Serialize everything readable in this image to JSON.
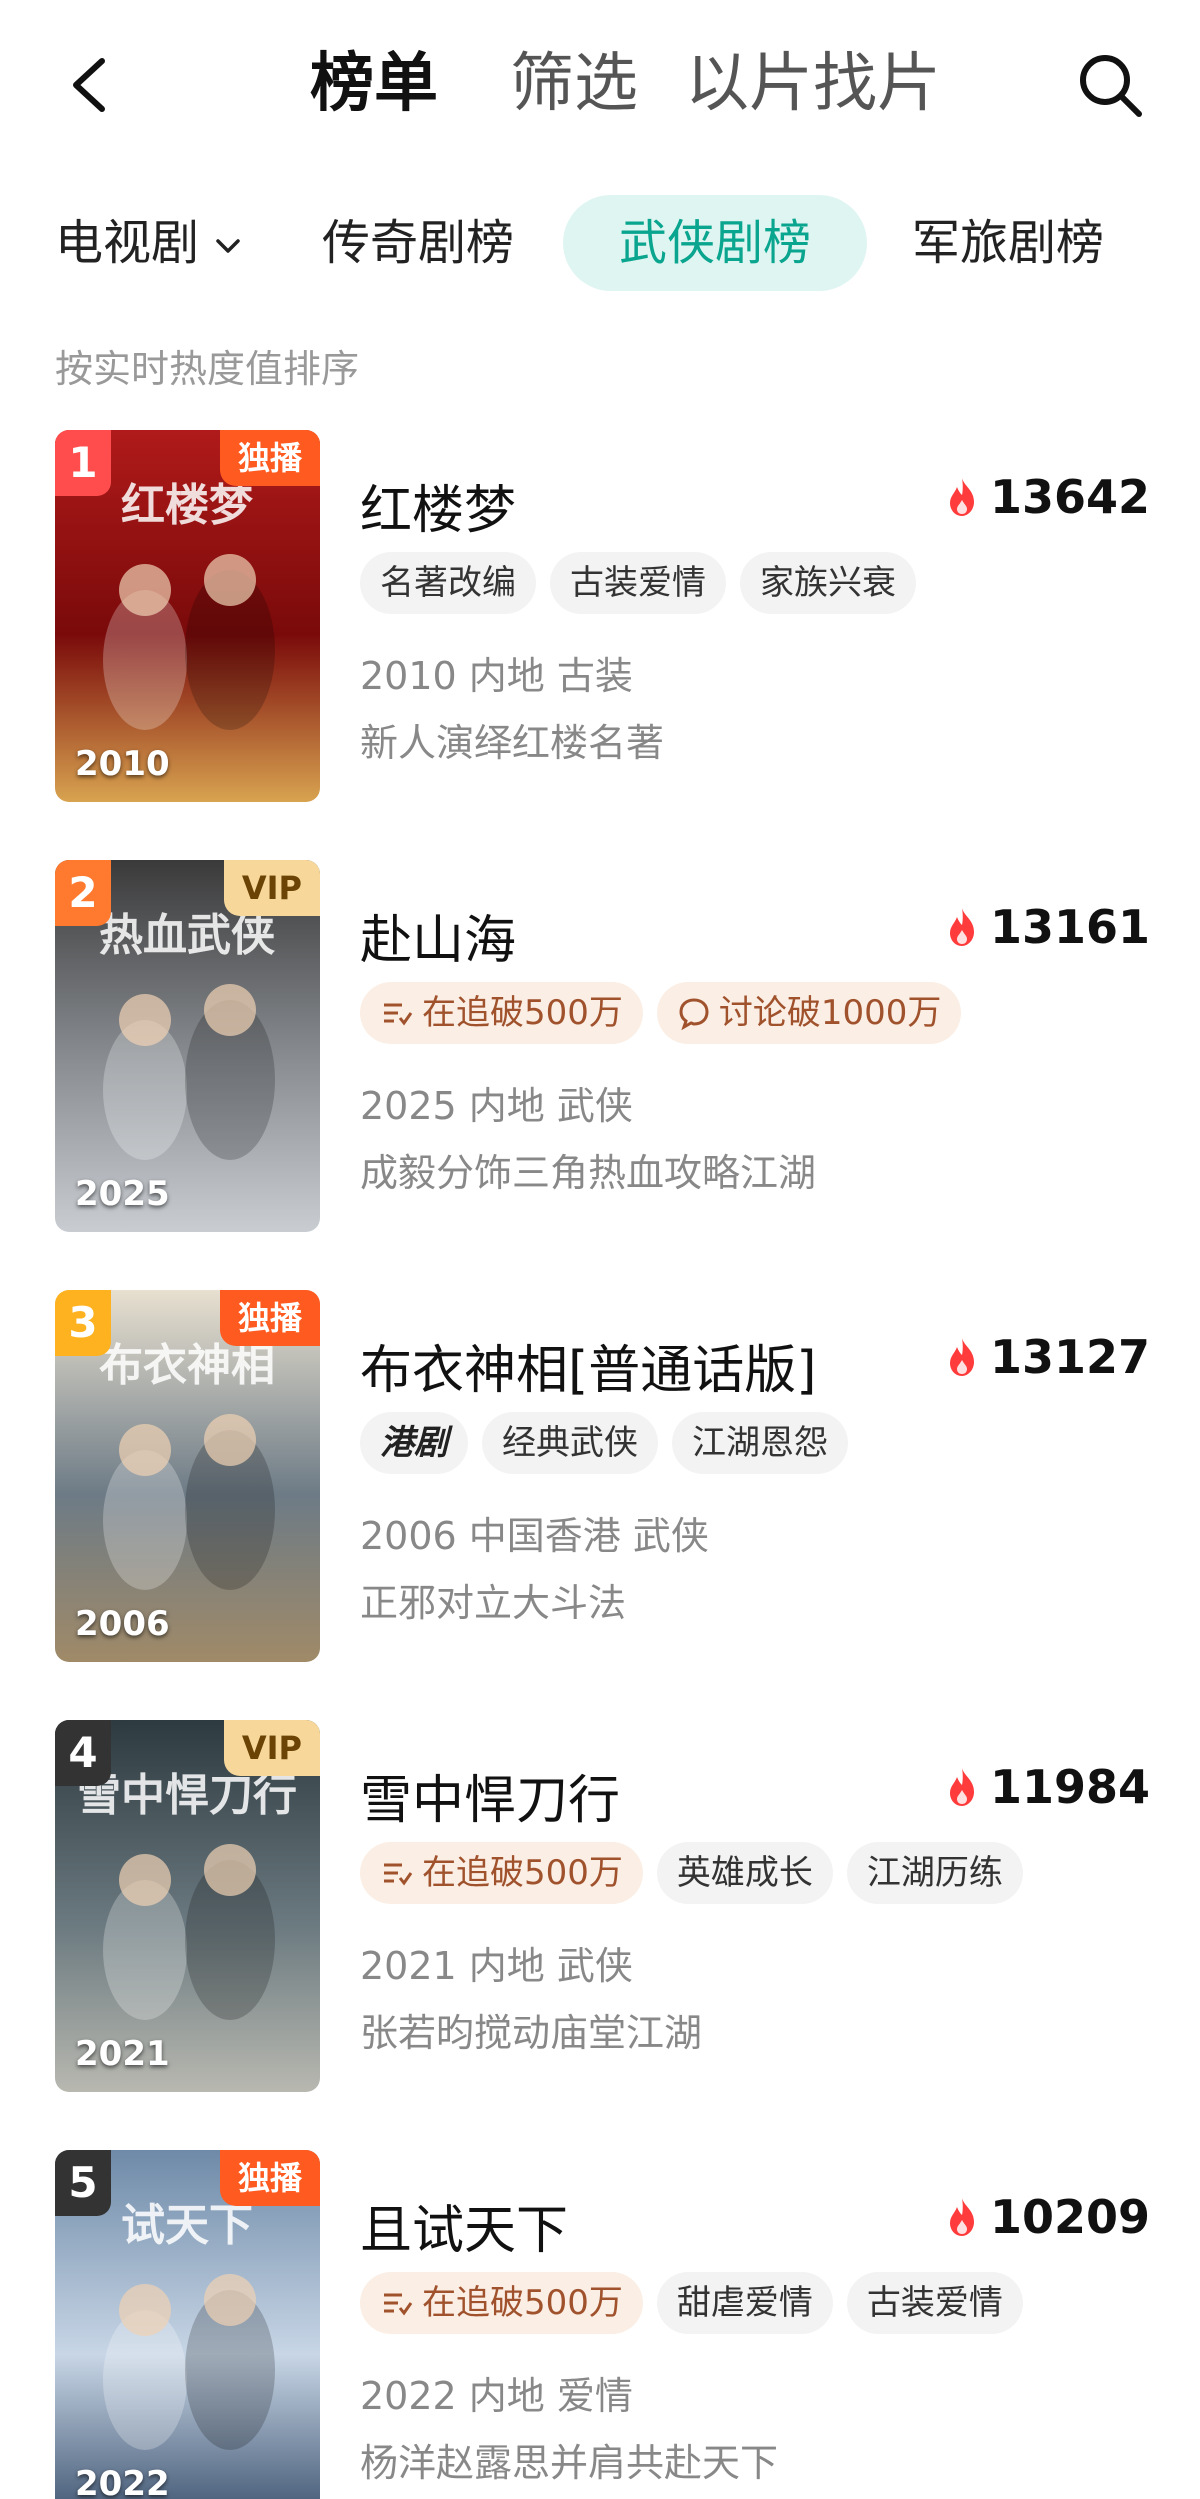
{
  "nav": {
    "tabs": [
      "榜单",
      "筛选",
      "以片找片"
    ]
  },
  "categories": {
    "dropdown": "电视剧",
    "items": [
      "传奇剧榜",
      "武侠剧榜",
      "军旅剧榜"
    ],
    "active_index": 1
  },
  "sort_note": "按实时热度值排序",
  "colors": {
    "accent": "#0aa58e",
    "accent_bg": "#dff5f1",
    "flame": "#ff3b3b",
    "exclusive": "#ff5a1f",
    "vip": "#f7d89a"
  },
  "items": [
    {
      "rank": "1",
      "badge": "独播",
      "year": "2010",
      "title": "红楼梦",
      "heat": "13642",
      "tags": [
        "名著改编",
        "古装爱情",
        "家族兴衰"
      ],
      "meta": "2010 内地 古装",
      "desc": "新人演绎红楼名著",
      "poster_text": "红楼梦"
    },
    {
      "rank": "2",
      "badge": "VIP",
      "year": "2025",
      "title": "赴山海",
      "heat": "13161",
      "tags": [
        "在追破500万",
        "讨论破1000万"
      ],
      "meta": "2025 内地 武侠",
      "desc": "成毅分饰三角热血攻略江湖",
      "poster_text": "热血武侠"
    },
    {
      "rank": "3",
      "badge": "独播",
      "year": "2006",
      "title": "布衣神相[普通话版]",
      "heat": "13127",
      "tags": [
        "港剧",
        "经典武侠",
        "江湖恩怨"
      ],
      "meta": "2006 中国香港 武侠",
      "desc": "正邪对立大斗法",
      "poster_text": "布衣神相"
    },
    {
      "rank": "4",
      "badge": "VIP",
      "year": "2021",
      "title": "雪中悍刀行",
      "heat": "11984",
      "tags": [
        "在追破500万",
        "英雄成长",
        "江湖历练"
      ],
      "meta": "2021 内地 武侠",
      "desc": "张若昀搅动庙堂江湖",
      "poster_text": "雪中悍刀行"
    },
    {
      "rank": "5",
      "badge": "独播",
      "year": "2022",
      "title": "且试天下",
      "heat": "10209",
      "tags": [
        "在追破500万",
        "甜虐爱情",
        "古装爱情"
      ],
      "meta": "2022 内地 爱情",
      "desc": "杨洋赵露思并肩共赴天下",
      "poster_text": "试天下"
    }
  ]
}
